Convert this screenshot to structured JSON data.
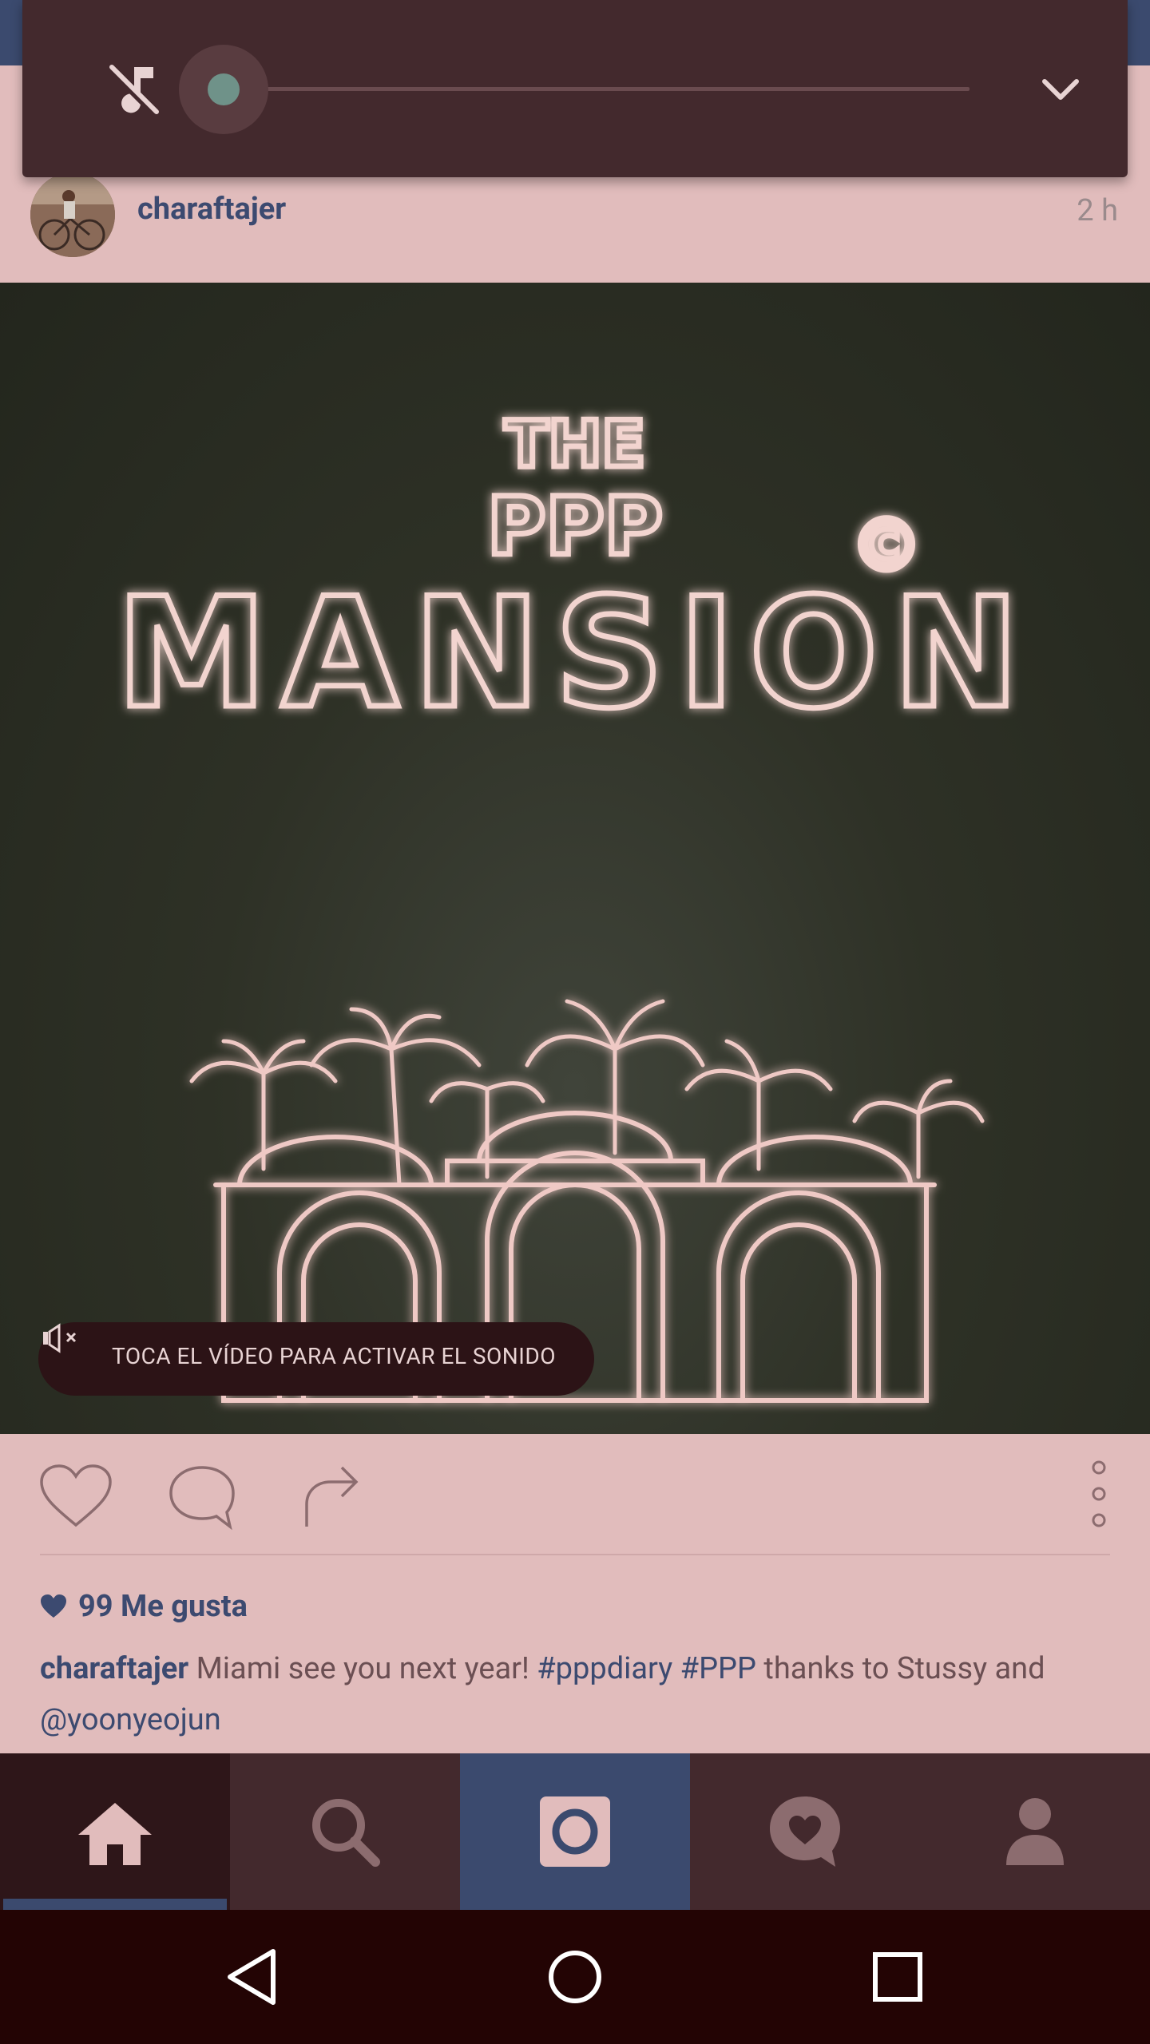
{
  "volume_panel": {
    "mute_icon": "music-off-icon",
    "slider_level": 0,
    "expand_icon": "chevron-down-icon"
  },
  "post": {
    "username": "charaftajer",
    "timestamp": "2 h",
    "video_title": {
      "line1": "THE",
      "line2": "PPP",
      "line3": "MANSION",
      "mark": "©"
    },
    "sound_prompt": "TOCA EL VÍDEO PARA ACTIVAR EL SONIDO",
    "likes": "99 Me gusta",
    "caption": {
      "user": "charaftajer",
      "text1": " Miami see you next year! ",
      "tag1": "#pppdiary",
      "space": " ",
      "tag2": "#PPP",
      "text2": " thanks to Stussy and ",
      "mention": "@yoonyeojun"
    }
  },
  "actions": {
    "like_icon": "heart-icon",
    "comment_icon": "comment-icon",
    "share_icon": "share-icon",
    "more_icon": "more-vertical-icon"
  },
  "bottom_nav": {
    "items": [
      "home-icon",
      "search-icon",
      "camera-icon",
      "activity-icon",
      "profile-icon"
    ],
    "active": "home"
  },
  "system_nav": [
    "back-icon",
    "home-circle-icon",
    "recents-icon"
  ],
  "colors": {
    "accent": "#3b4a6e",
    "background": "#e1bcbc",
    "nav_background": "#43292d",
    "system_nav": "#230404"
  }
}
